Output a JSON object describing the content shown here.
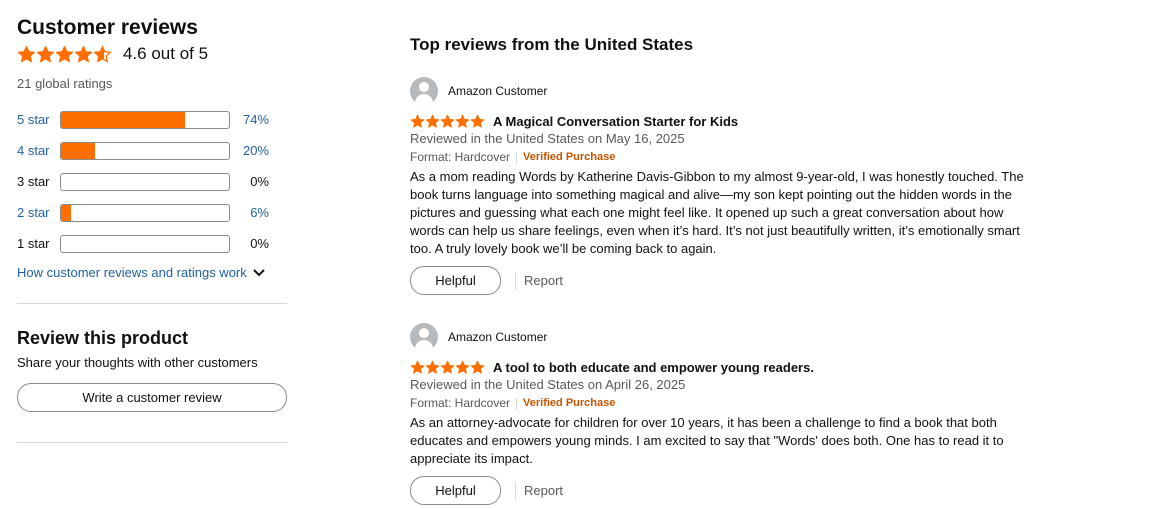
{
  "summary": {
    "title": "Customer reviews",
    "average_text": "4.6 out of 5",
    "average_rating": 4.6,
    "global_ratings": "21 global ratings",
    "histogram": [
      {
        "label": "5 star",
        "pct_text": "74%",
        "pct": 74,
        "link": true
      },
      {
        "label": "4 star",
        "pct_text": "20%",
        "pct": 20,
        "link": true
      },
      {
        "label": "3 star",
        "pct_text": "0%",
        "pct": 0,
        "link": false
      },
      {
        "label": "2 star",
        "pct_text": "6%",
        "pct": 6,
        "link": true
      },
      {
        "label": "1 star",
        "pct_text": "0%",
        "pct": 0,
        "link": false
      }
    ],
    "how_link": "How customer reviews and ratings work"
  },
  "review_product": {
    "title": "Review this product",
    "subtitle": "Share your thoughts with other customers",
    "button": "Write a customer review"
  },
  "reviews_section": {
    "title": "Top reviews from the United States",
    "reviews": [
      {
        "author": "Amazon Customer",
        "rating": 5,
        "title": "A Magical Conversation Starter for Kids",
        "date": "Reviewed in the United States on May 16, 2025",
        "format": "Format: Hardcover",
        "verified": "Verified Purchase",
        "body": "As a mom reading Words by Katherine Davis-Gibbon to my almost 9-year-old, I was honestly touched. The book turns language into something magical and alive—my son kept pointing out the hidden words in the pictures and guessing what each one might feel like. It opened up such a great conversation about how words can help us share feelings, even when it’s hard. It’s not just beautifully written, it’s emotionally smart too. A truly lovely book we’ll be coming back to again.",
        "helpful": "Helpful",
        "report": "Report"
      },
      {
        "author": "Amazon Customer",
        "rating": 5,
        "title": "A tool to both educate and empower young readers.",
        "date": "Reviewed in the United States on April 26, 2025",
        "format": "Format: Hardcover",
        "verified": "Verified Purchase",
        "body": "As an attorney-advocate for children for over 10 years, it has been a challenge to find a book that both educates and empowers young minds. I am excited to say that \"Words' does both. One has to read it to appreciate its impact.",
        "helpful": "Helpful",
        "report": "Report"
      }
    ]
  },
  "colors": {
    "star": "#ff6f00",
    "link": "#2162a1",
    "verified": "#c45500",
    "bar_fill": "#ff6f00"
  }
}
